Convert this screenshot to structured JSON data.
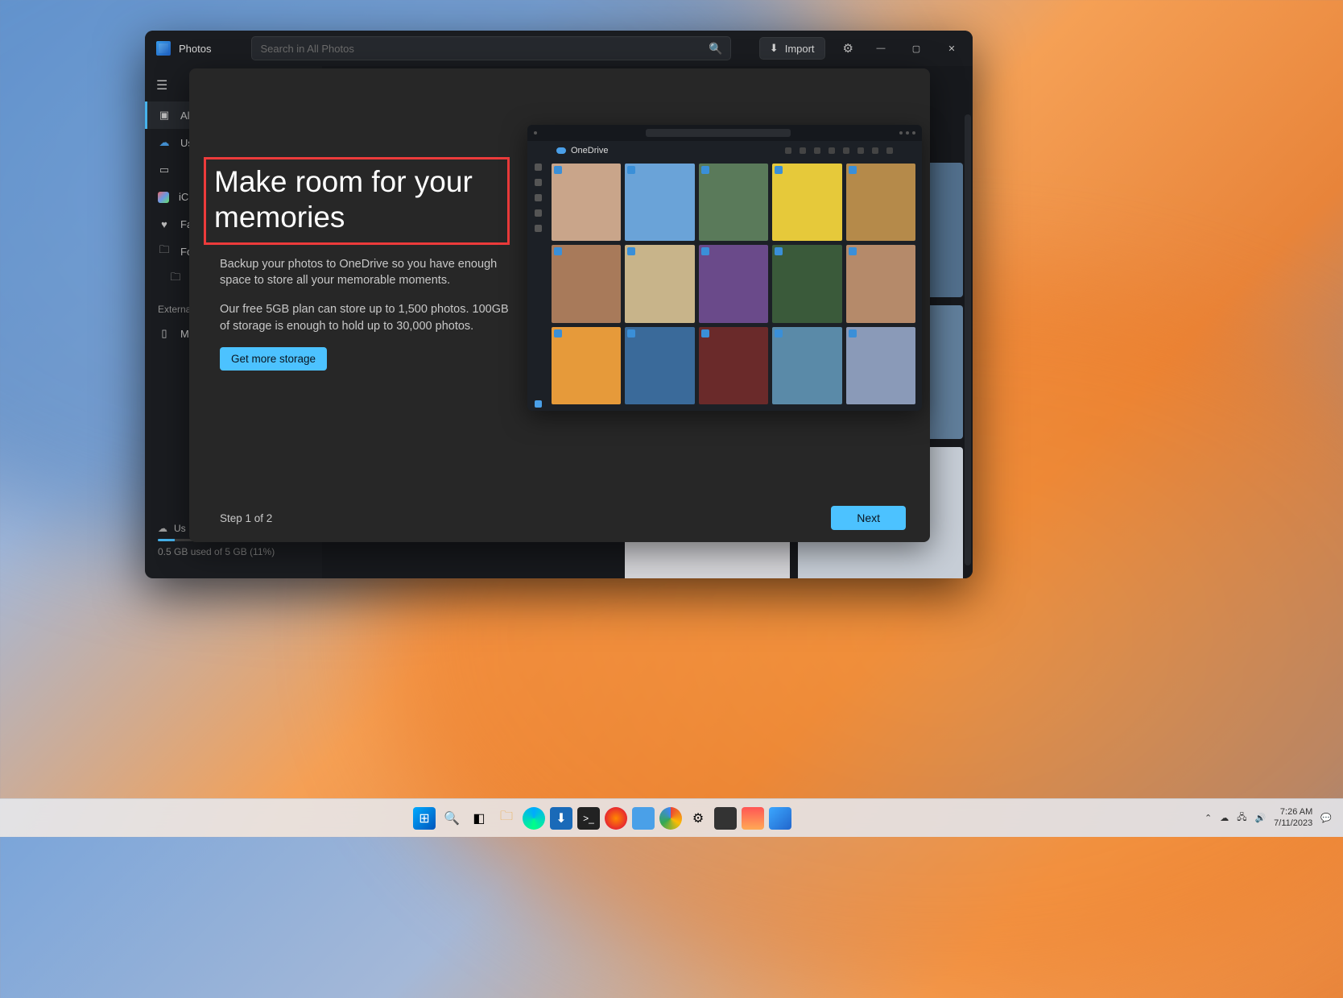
{
  "app": {
    "title": "Photos"
  },
  "search": {
    "placeholder": "Search in All Photos"
  },
  "titlebar": {
    "import_label": "Import"
  },
  "sidebar": {
    "items": [
      {
        "label": "All Photos"
      },
      {
        "label": "Us"
      },
      {
        "label": ""
      },
      {
        "label": "iCloud Photos"
      },
      {
        "label": "Favorites"
      },
      {
        "label": "Folders"
      },
      {
        "label": ""
      }
    ],
    "external_header": "External",
    "external_item": "My Phone",
    "storage_line1": "Us",
    "storage_line2": "0.5 GB used of 5 GB (11%)",
    "storage_pct": 11
  },
  "modal": {
    "title": "Make room for your memories",
    "p1": "Backup your photos to OneDrive so you have enough space to store all your memorable moments.",
    "p2": "Our free 5GB plan can store up to 1,500 photos. 100GB of storage is enough to hold up to 30,000 photos.",
    "cta_label": "Get more storage",
    "step_label": "Step 1 of 2",
    "next_label": "Next",
    "preview_label": "OneDrive"
  },
  "od_colors": [
    "#c9a58a",
    "#6aa3d8",
    "#5a7a5a",
    "#e6c93a",
    "#b58a4a",
    "#a87a5a",
    "#c8b48a",
    "#6a4a8a",
    "#3a5a3a",
    "#b58a6a",
    "#e69a3a",
    "#3a6a9a",
    "#6a2a2a",
    "#5a8aa8",
    "#8a9ab8"
  ],
  "taskbar": {
    "time": "7:26 AM",
    "date": "7/11/2023"
  }
}
